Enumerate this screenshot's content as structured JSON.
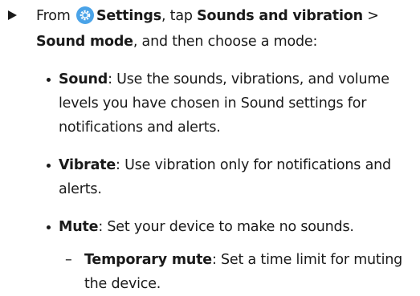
{
  "intro": {
    "from": "From",
    "settings": "Settings",
    "tap": ", tap",
    "sounds_vibration": "Sounds and vibration",
    "chevron": " >",
    "sound_mode": "Sound mode",
    "then": ", and then choose a mode:"
  },
  "modes": [
    {
      "name": "Sound",
      "desc": ": Use the sounds, vibrations, and volume levels you have chosen in Sound settings for notifications and alerts."
    },
    {
      "name": "Vibrate",
      "desc": ": Use vibration only for notifications and alerts."
    },
    {
      "name": "Mute",
      "desc": ": Set your device to make no sounds."
    }
  ],
  "sub_modes": [
    {
      "dash": "–",
      "name": "Temporary mute",
      "desc": ": Set a time limit for muting the device."
    }
  ],
  "icons": {
    "step": "triangle-right-icon",
    "settings": "settings-gear-icon"
  },
  "colors": {
    "settings_icon": "#4aa3e8",
    "text": "#1a1a1a"
  }
}
